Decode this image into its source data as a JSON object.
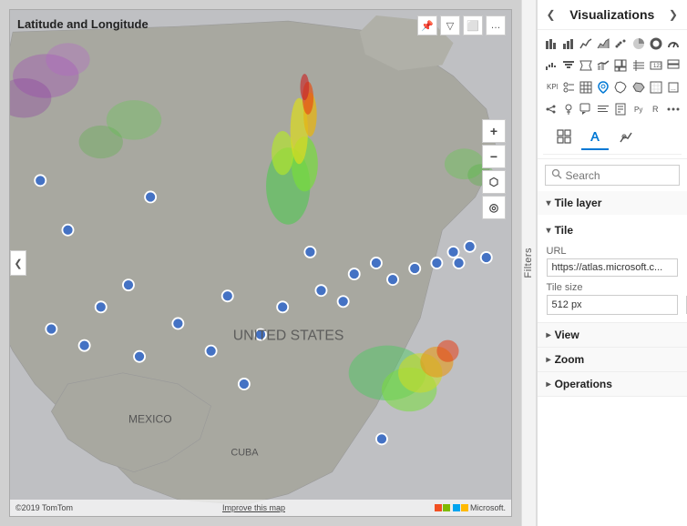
{
  "map": {
    "title": "Latitude and Longitude",
    "footer_copyright": "©2019 TomTom",
    "footer_link": "Improve this map",
    "footer_brand": "Microsoft.",
    "controls": {
      "zoom_in": "+",
      "zoom_out": "−",
      "location": "⬡",
      "compass": "◎"
    },
    "toolbar_buttons": [
      "📌",
      "▽",
      "⬜",
      "…"
    ]
  },
  "filter": {
    "label": "Filters"
  },
  "visualizations_panel": {
    "title": "Visualizations",
    "chevron_left": "❮",
    "chevron_right": "❯",
    "search_placeholder": "Search",
    "search_label": "Search",
    "tabs": [
      {
        "id": "fields",
        "icon": "⊞",
        "label": "Fields tab"
      },
      {
        "id": "format",
        "icon": "🖌",
        "label": "Format tab",
        "active": true
      },
      {
        "id": "analytics",
        "icon": "☞",
        "label": "Analytics tab"
      }
    ],
    "sections": [
      {
        "id": "tile-layer",
        "label": "Tile layer",
        "expanded": true,
        "sub_sections": [
          {
            "id": "tile",
            "label": "Tile",
            "expanded": true,
            "fields": [
              {
                "id": "url",
                "label": "URL",
                "value": "https://atlas.microsoft.c...",
                "placeholder": ""
              },
              {
                "id": "tile-size",
                "label": "Tile size",
                "value": "512 px",
                "has_spinner": true
              }
            ]
          }
        ]
      },
      {
        "id": "view",
        "label": "View",
        "expanded": false
      },
      {
        "id": "zoom",
        "label": "Zoom",
        "expanded": false
      },
      {
        "id": "operations",
        "label": "Operations",
        "expanded": false
      }
    ]
  },
  "icons": {
    "row1": [
      "⊞",
      "▐▐",
      "≡≡",
      "▤",
      "▥",
      "▦",
      "▧",
      "▨"
    ],
    "row2": [
      "∿",
      "🗠",
      "≈",
      "⌇",
      "⌒",
      "📈",
      "📊",
      "🔢"
    ],
    "row3": [
      "▦",
      "⊡",
      "⊞",
      "◫",
      "◈",
      "◉",
      "⊙",
      "⊗"
    ],
    "row4": [
      "⬡",
      "🗺",
      "●",
      "◼",
      "▲",
      "⊕",
      "⊞",
      "⊟"
    ],
    "row5": [
      "💬",
      "🖼",
      "⋯",
      "⋮",
      "⋱",
      "⋰",
      "⊻",
      "⊼"
    ]
  }
}
